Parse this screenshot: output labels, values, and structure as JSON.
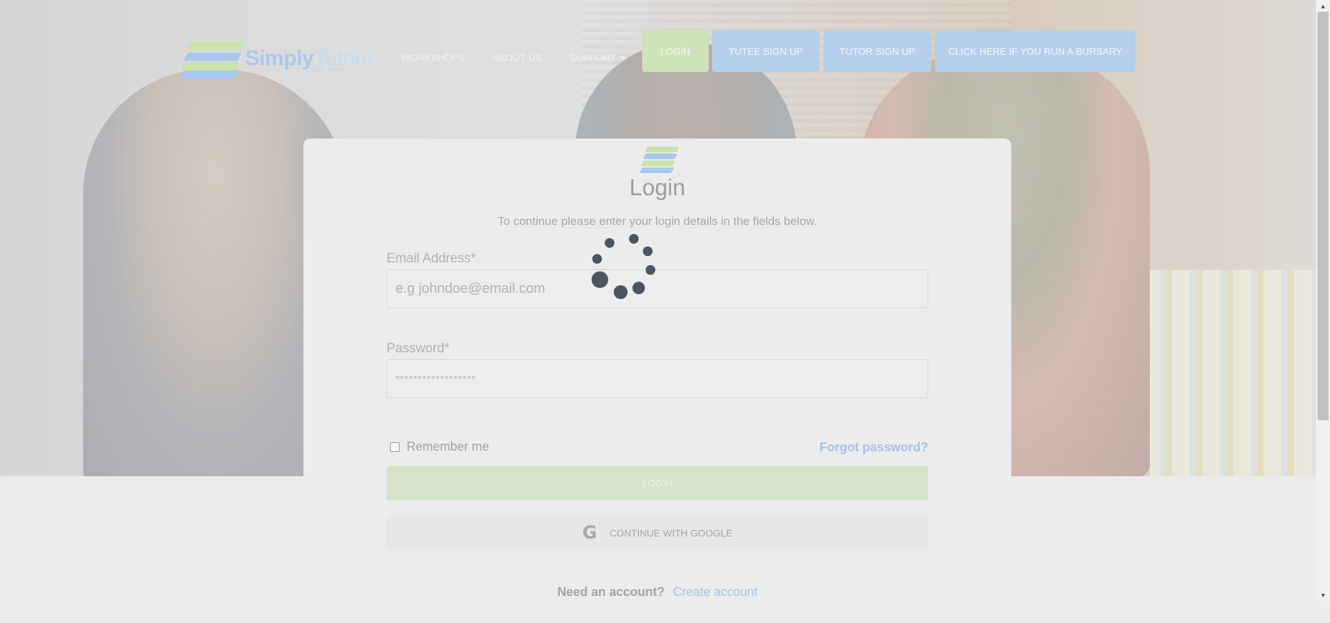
{
  "brand": {
    "name_strong": "Simply",
    "name_rest": "Tutors",
    "tagline": "EST. 2020"
  },
  "nav": {
    "workshops": "WORKSHOPS",
    "about": "ABOUT US",
    "support": "SUPPORT",
    "login": "LOGIN",
    "tutee_signup": "TUTEE SIGN UP",
    "tutor_signup": "TUTOR SIGN UP",
    "bursary": "CLICK HERE IF YOU RUN A BURSARY"
  },
  "login_card": {
    "title": "Login",
    "subtitle": "To continue please enter your login details in the fields below.",
    "email_label": "Email Address*",
    "email_placeholder": "e.g johndoe@email.com",
    "password_label": "Password*",
    "password_placeholder": "******************",
    "remember_label": "Remember me",
    "forgot_label": "Forgot password?",
    "login_button": "LOGIN",
    "google_button": "CONTINUE WITH GOOGLE",
    "need_account": "Need an account?",
    "create_account": "Create account"
  },
  "colors": {
    "brand_green": "#c9e3a9",
    "brand_blue": "#a9c8ee",
    "link_blue": "#a7c2e3",
    "spinner": "#4d5660"
  },
  "icons": {
    "google": "google-g-icon",
    "spinner": "loading-spinner-icon",
    "caret": "chevron-down-icon"
  }
}
